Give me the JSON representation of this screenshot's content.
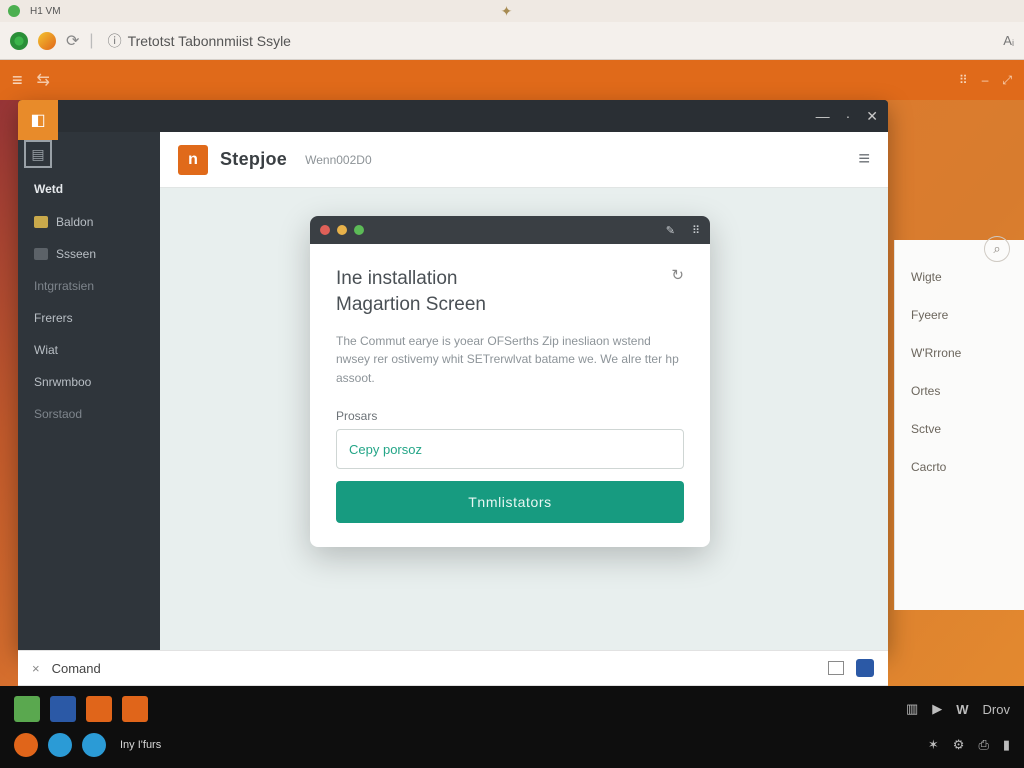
{
  "os_menubar": {
    "label": "H1 VM"
  },
  "browser": {
    "url_text": "Tretotst Tabonnmiist Ssyle",
    "right_glyph": "Aᵢ"
  },
  "orange_bar": {
    "right_items": [
      "⠿",
      "–",
      "⤢"
    ]
  },
  "window_controls": {
    "min": "—",
    "mid": "·",
    "close": "✕"
  },
  "sidebar": {
    "heading": "Wetd",
    "items": [
      {
        "label": "Baldon",
        "icon": "fold"
      },
      {
        "label": "Ssseen",
        "icon": "hdr"
      },
      {
        "label": "Intgrratsien",
        "muted": true
      },
      {
        "label": "Frerers"
      },
      {
        "label": "Wiat"
      },
      {
        "label": "Snrwmboo"
      },
      {
        "label": "Sorstaod",
        "muted": true
      }
    ]
  },
  "content_header": {
    "brand_badge": "n",
    "brand": "Stepjoe",
    "sub": "Wenn002D0"
  },
  "modal": {
    "title_line1": "Ine installation",
    "title_line2": "Magartion Screen",
    "description": "The Commut earye is yoear OFSerths Zip inesliaon wstend nwsey rer ostivemy whit SETrerwlvat batame we. We alre tter hp assoot.",
    "field_label": "Prosars",
    "placeholder": "Cepy porsoz",
    "button": "Tnmlistators",
    "reload_icon": "↻"
  },
  "right_panel": {
    "items": [
      "Wigte",
      "Fyeere",
      "W'Rrrone",
      "Ortes",
      "Sctve",
      "Cacrto"
    ]
  },
  "cmdbar": {
    "label": "Comand"
  },
  "taskbar": {
    "tiles": [
      {
        "color": "#5aa84f"
      },
      {
        "color": "#2b59a6"
      },
      {
        "color": "#e0651a"
      },
      {
        "color": "#e0651a"
      }
    ],
    "tiles_label": "Iny I'furs",
    "circles": [
      {
        "color": "#e0651a"
      },
      {
        "color": "#2b9bd6"
      },
      {
        "color": "#2b9bd6"
      }
    ],
    "right": {
      "play": "▶",
      "app": "W",
      "label": "Drov"
    }
  },
  "colors": {
    "accent": "#e06a1a",
    "teal": "#179b80"
  }
}
